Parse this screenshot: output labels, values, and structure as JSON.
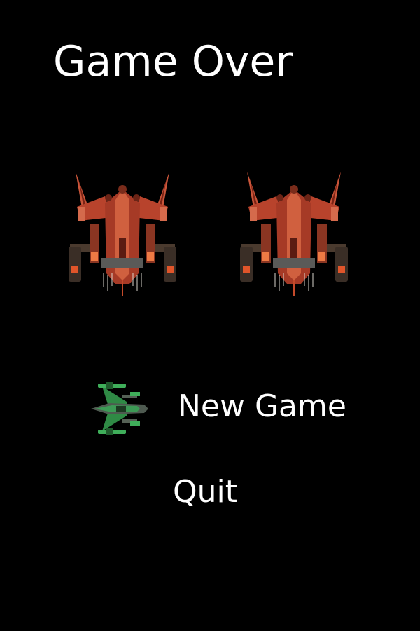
{
  "screen": {
    "title": "Game Over"
  },
  "menu": {
    "items": [
      {
        "label": "New Game",
        "selected": true
      },
      {
        "label": "Quit",
        "selected": false
      }
    ]
  },
  "sprites": {
    "enemy_icon": "red-enemy-gunship",
    "cursor_icon": "green-player-fighter",
    "enemy_count": 2
  },
  "colors": {
    "background": "#000000",
    "text": "#ffffff",
    "enemy_hull": "#b8432c",
    "player_hull": "#2f8a45"
  }
}
